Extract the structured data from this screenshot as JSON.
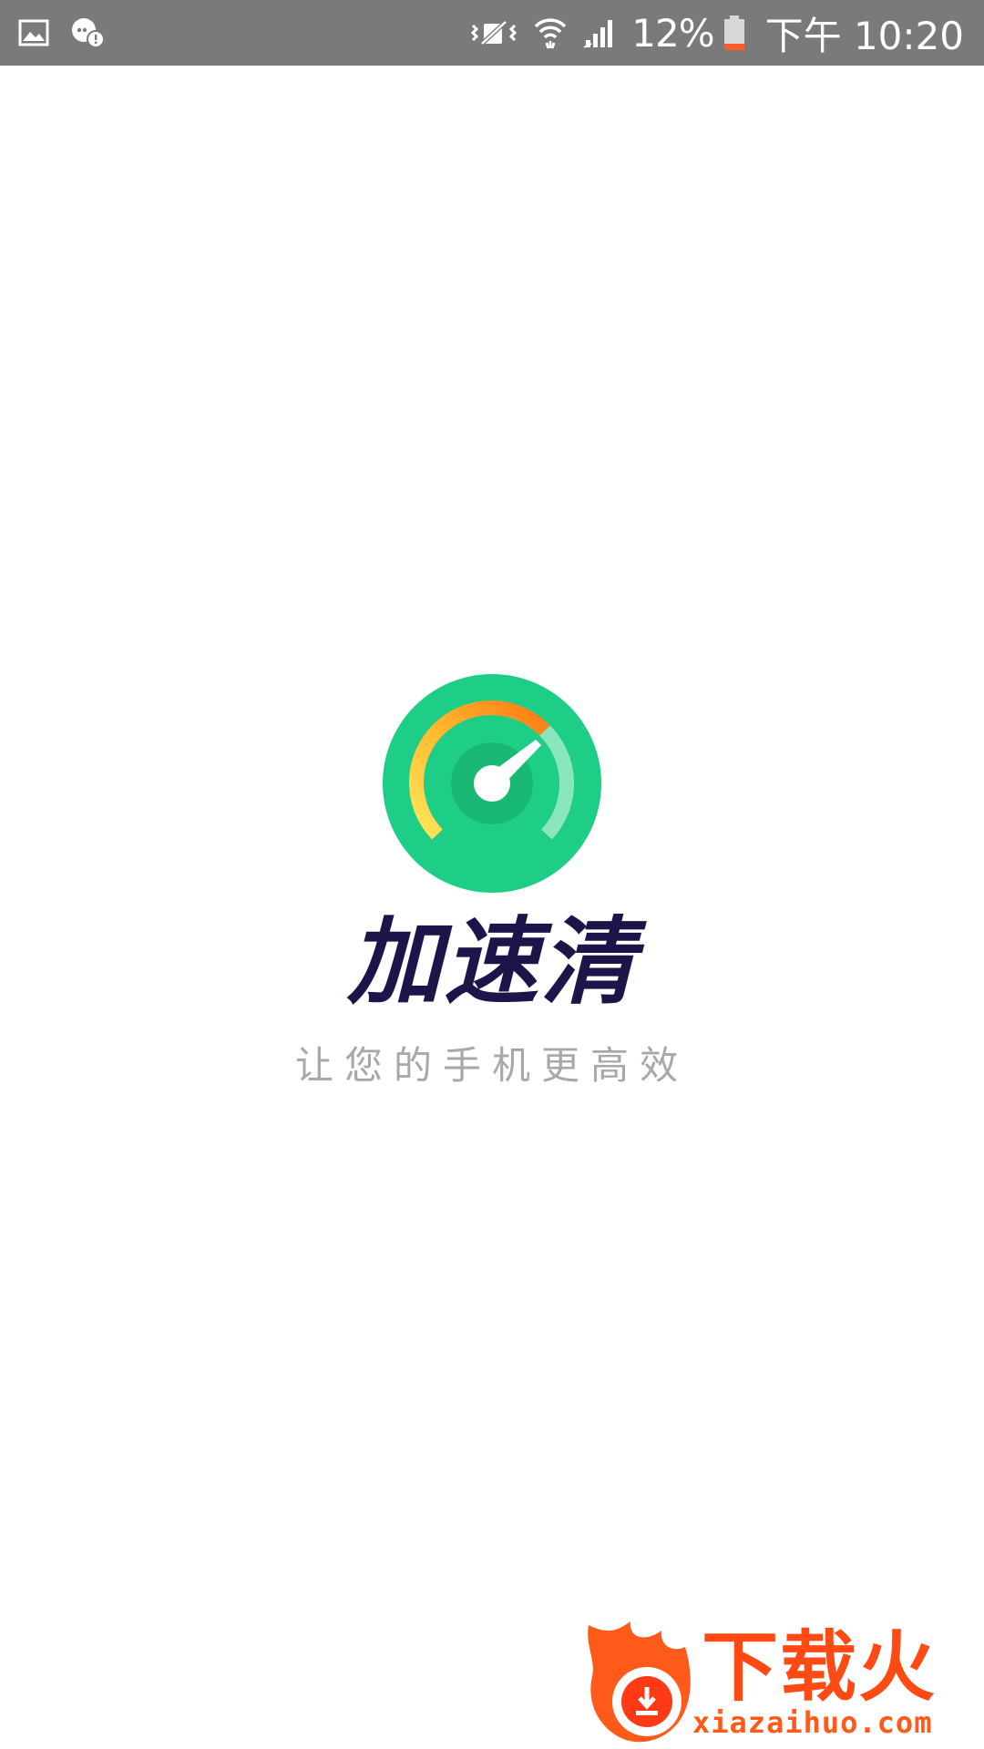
{
  "status_bar": {
    "left_icons": [
      "image-notification-icon",
      "message-notification-icon"
    ],
    "right_icons": [
      "vibrate-mute-icon",
      "wifi-icon",
      "cell-signal-icon",
      "battery-low-icon"
    ],
    "battery_percent": "12%",
    "time": "下午 10:20"
  },
  "splash": {
    "logo_icon": "speedometer-icon",
    "app_name": "加速清",
    "slogan": "让您的手机更高效"
  },
  "watermark": {
    "logo_icon": "flame-download-icon",
    "chars": "下载火",
    "url": "xiazaihuo.com"
  },
  "colors": {
    "status_bar_bg": "#7a7a7a",
    "logo_green": "#1fce86",
    "logo_dark_green": "#18b873",
    "gauge_orange": "#ff8a1a",
    "gauge_yellow": "#ffd84a",
    "app_name": "#1c1549",
    "slogan": "#a8a8a8",
    "watermark_orange": "#ff4a14"
  }
}
